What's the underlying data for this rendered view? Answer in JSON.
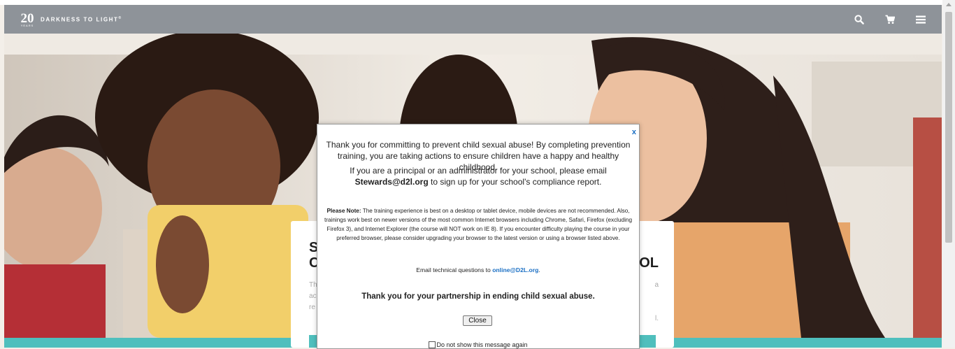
{
  "header": {
    "logo_number": "20",
    "logo_years": "YEARS",
    "logo_text": "DARKNESS TO LIGHT",
    "logo_trademark": "®",
    "icons": [
      "search-icon",
      "cart-icon",
      "menu-icon"
    ]
  },
  "card": {
    "title_line1_left": "S",
    "title_line2_left": "C",
    "title_line2_right": "OL",
    "body_lines": [
      {
        "left": "Th",
        "right": "a"
      },
      {
        "left": "ac",
        "right": ""
      },
      {
        "left": "re",
        "right": "l."
      }
    ]
  },
  "modal": {
    "close_x": "x",
    "intro": "Thank you for committing to prevent child sexual abuse! By completing prevention training, you are taking actions to ensure children have a happy and healthy childhood.",
    "admin_prefix": "If you are a principal or an administrator for your school, please email ",
    "admin_email": "Stewards@d2l.org",
    "admin_suffix": " to sign up for your school's compliance report.",
    "note_label": "Please Note:",
    "note_text": " The training experience is best on a desktop or tablet device, mobile devices are not recommended. Also, trainings work best on newer versions of the most common Internet browsers including Chrome, Safari, Firefox (excluding Firefox 3), and Internet Explorer (the course will NOT work on IE 8). If you encounter difficulty playing the course in your preferred browser, please consider upgrading your browser to the latest version or using a browser listed above.",
    "tech_prefix": "Email technical questions to ",
    "tech_email": "online@D2L.org",
    "tech_suffix": ".",
    "thanks": "Thank you for your partnership in ending child sexual abuse.",
    "close_button": "Close",
    "dont_show": "Do not show this message again",
    "dont_show_checked": false
  },
  "colors": {
    "navbar": "#8e9399",
    "accent_teal": "#4fbfbd",
    "link": "#1a6fc4"
  }
}
